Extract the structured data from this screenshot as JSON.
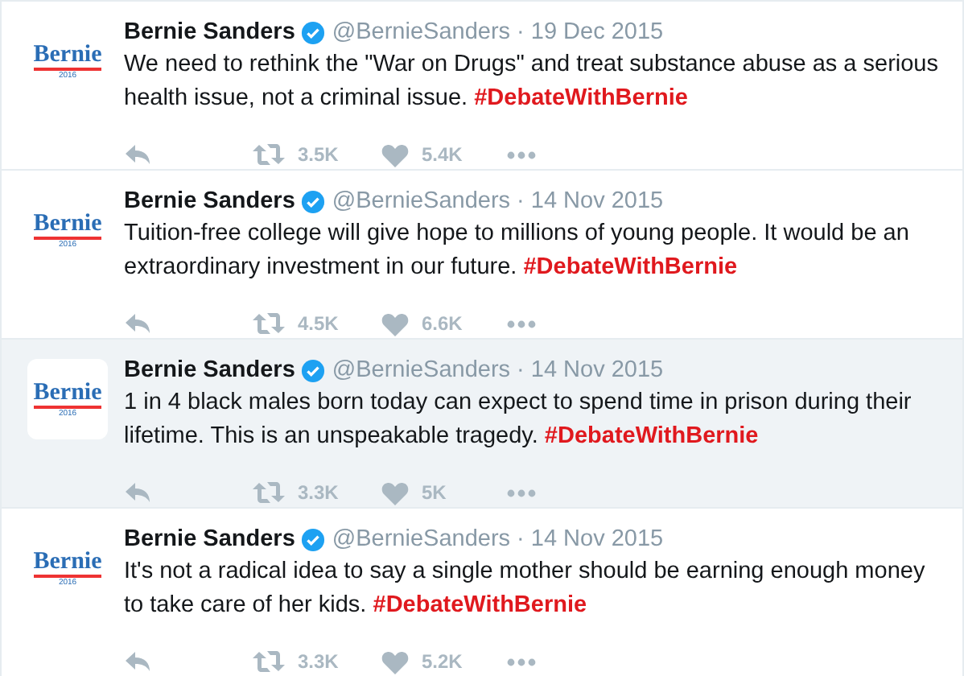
{
  "tweets": [
    {
      "avatar": {
        "word": "Bernie",
        "year": "2016"
      },
      "name": "Bernie Sanders",
      "verified": true,
      "handle": "@BernieSanders",
      "separator": "·",
      "date": "19 Dec 2015",
      "text": "We need to rethink the \"War on Drugs\" and treat substance abuse as a serious health issue, not a criminal issue.",
      "hashtag": "#DebateWithBernie",
      "retweets": "3.5K",
      "likes": "5.4K",
      "hovered": false
    },
    {
      "avatar": {
        "word": "Bernie",
        "year": "2016"
      },
      "name": "Bernie Sanders",
      "verified": true,
      "handle": "@BernieSanders",
      "separator": "·",
      "date": "14 Nov 2015",
      "text": "Tuition-free college will give hope to millions of young people. It would be an extraordinary investment in our future.",
      "hashtag": "#DebateWithBernie",
      "retweets": "4.5K",
      "likes": "6.6K",
      "hovered": false
    },
    {
      "avatar": {
        "word": "Bernie",
        "year": "2016"
      },
      "name": "Bernie Sanders",
      "verified": true,
      "handle": "@BernieSanders",
      "separator": "·",
      "date": "14 Nov 2015",
      "text": "1 in 4 black males born today can expect to spend time in prison during their lifetime. This is an unspeakable tragedy.",
      "hashtag": "#DebateWithBernie",
      "retweets": "3.3K",
      "likes": "5K",
      "hovered": true
    },
    {
      "avatar": {
        "word": "Bernie",
        "year": "2016"
      },
      "name": "Bernie Sanders",
      "verified": true,
      "handle": "@BernieSanders",
      "separator": "·",
      "date": "14 Nov 2015",
      "text": "It's not a radical idea to say a single mother should be earning enough money to take care of her kids.",
      "hashtag": "#DebateWithBernie",
      "retweets": "3.3K",
      "likes": "5.2K",
      "hovered": false
    }
  ]
}
